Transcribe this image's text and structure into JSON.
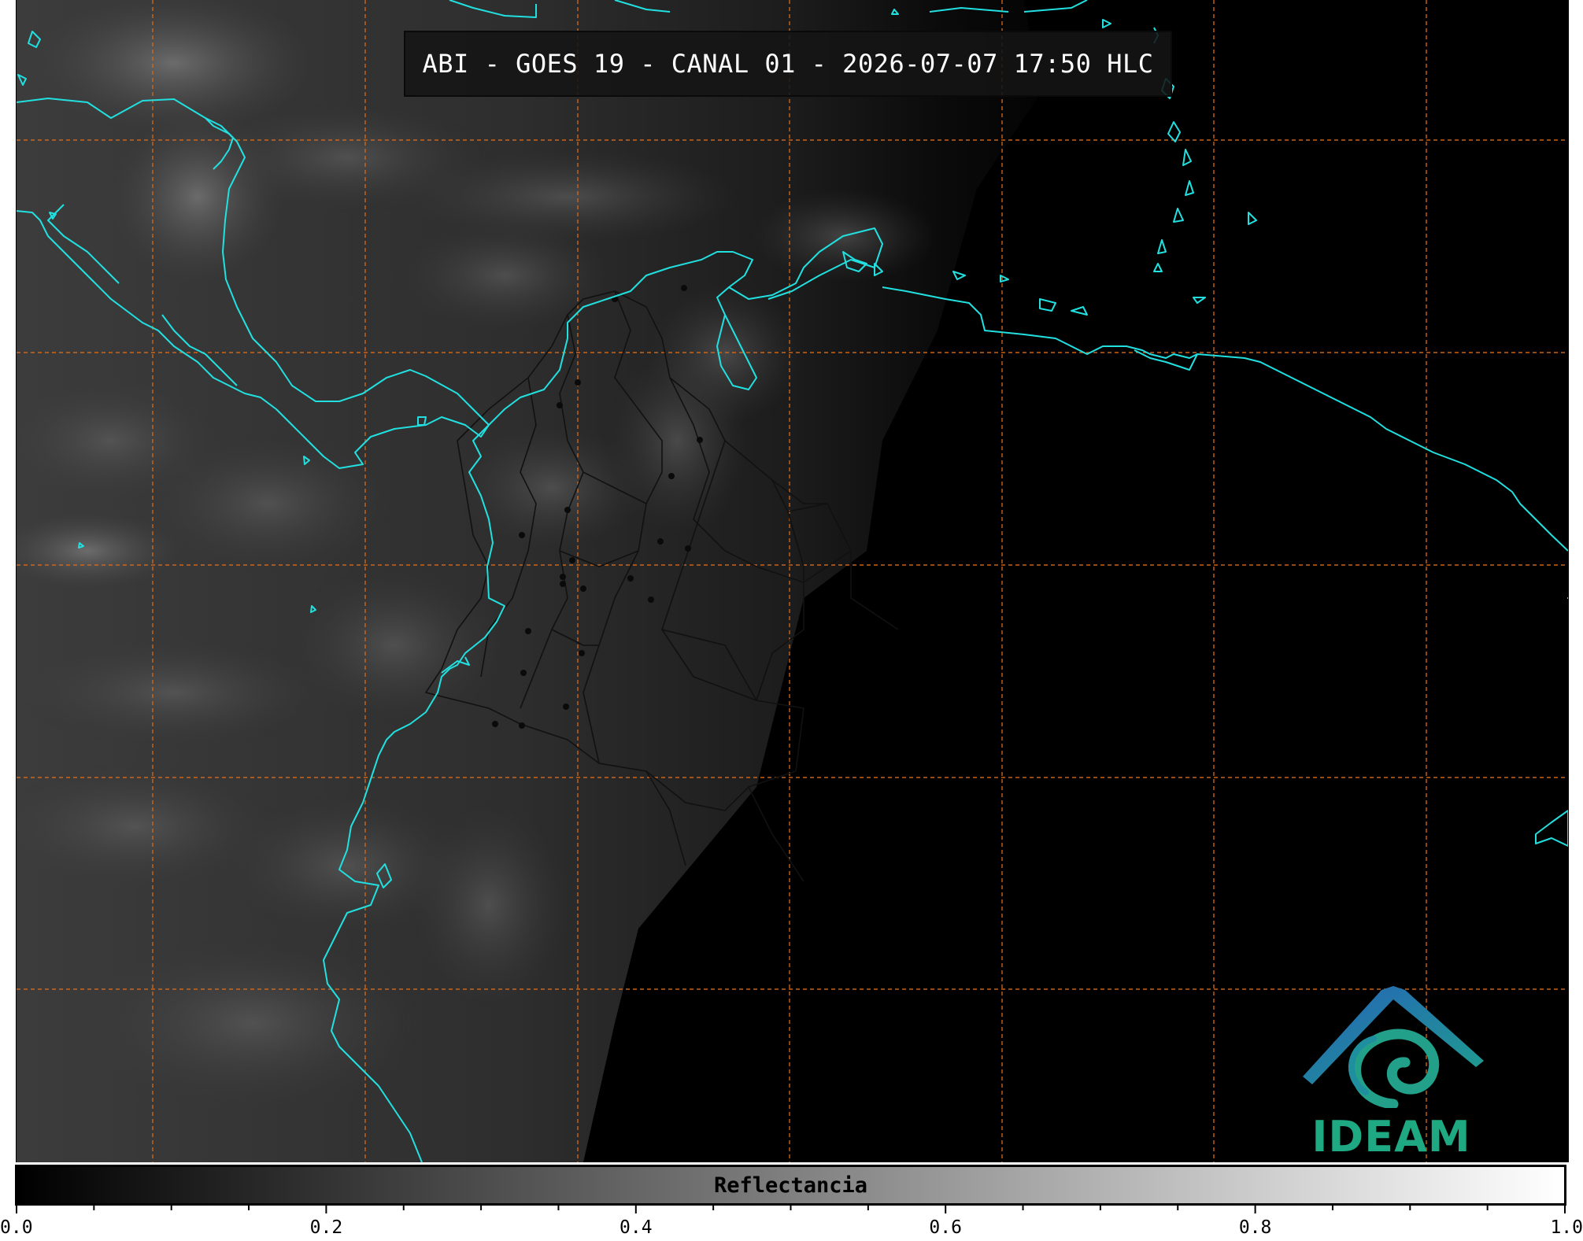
{
  "header": {
    "title": "ABI - GOES 19 - CANAL 01 - 2026-07-07 17:50 HLC"
  },
  "colorbar": {
    "label": "Reflectancia",
    "min": 0.0,
    "max": 1.0,
    "tick_labels": [
      "0.0",
      "0.2",
      "0.4",
      "0.6",
      "0.8",
      "1.0"
    ],
    "minor_step": 0.05,
    "color_low": "#000000",
    "color_high": "#ffffff"
  },
  "logo": {
    "text": "IDEAM",
    "color_text": "#1ea983",
    "color_roof": "#2563b8",
    "color_swirl": "#22a08a"
  },
  "map": {
    "gridline_color": "#d2691e",
    "coastline_color": "#22e0e0",
    "border_color": "#111111"
  }
}
